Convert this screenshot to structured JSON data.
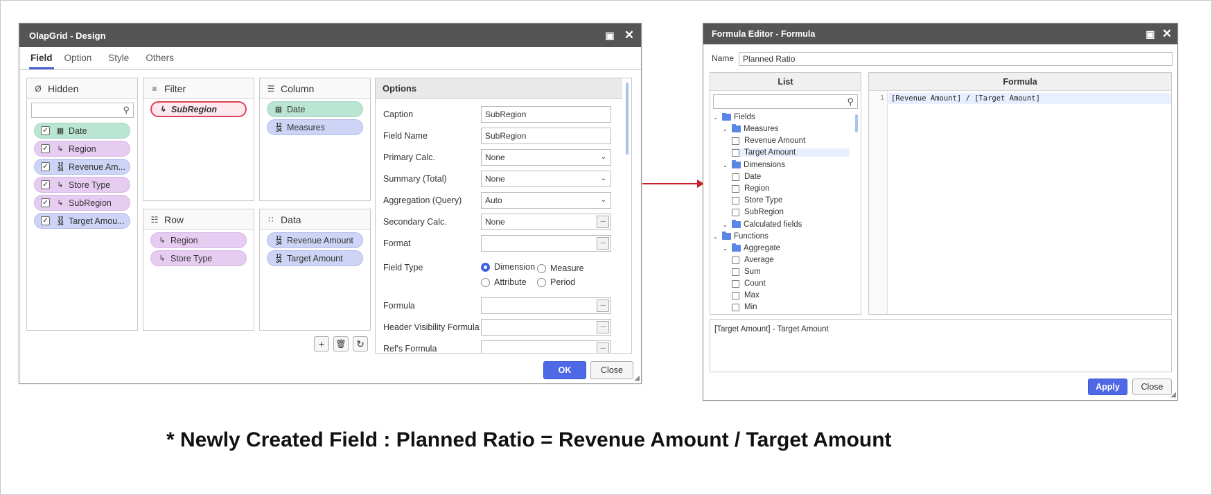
{
  "design_window": {
    "title": "OlapGrid - Design",
    "tabs": [
      "Field",
      "Option",
      "Style",
      "Others"
    ],
    "hidden_panel": {
      "title": "Hidden",
      "items": [
        {
          "label": "Date",
          "type": "date",
          "color": "green"
        },
        {
          "label": "Region",
          "type": "dimension",
          "color": "purple"
        },
        {
          "label": "Revenue Am...",
          "type": "measure",
          "color": "blue"
        },
        {
          "label": "Store Type",
          "type": "dimension",
          "color": "purple"
        },
        {
          "label": "SubRegion",
          "type": "dimension",
          "color": "purple"
        },
        {
          "label": "Target Amou...",
          "type": "measure",
          "color": "blue"
        }
      ]
    },
    "filter_panel": {
      "title": "Filter",
      "items": [
        {
          "label": "SubRegion"
        }
      ]
    },
    "column_panel": {
      "title": "Column",
      "items": [
        {
          "label": "Date"
        },
        {
          "label": "Measures"
        }
      ]
    },
    "row_panel": {
      "title": "Row",
      "items": [
        {
          "label": "Region"
        },
        {
          "label": "Store Type"
        }
      ]
    },
    "data_panel": {
      "title": "Data",
      "items": [
        {
          "label": "Revenue Amount"
        },
        {
          "label": "Target Amount"
        }
      ]
    },
    "options": {
      "title": "Options",
      "caption_label": "Caption",
      "caption_value": "SubRegion",
      "field_name_label": "Field Name",
      "field_name_value": "SubRegion",
      "primary_calc_label": "Primary Calc.",
      "primary_calc_value": "None",
      "summary_label": "Summary (Total)",
      "summary_value": "None",
      "aggregation_label": "Aggregation (Query)",
      "aggregation_value": "Auto",
      "secondary_calc_label": "Secondary Calc.",
      "secondary_calc_value": "None",
      "format_label": "Format",
      "format_value": "",
      "field_type_label": "Field Type",
      "field_types": [
        "Dimension",
        "Measure",
        "Attribute",
        "Period"
      ],
      "field_type_selected": "Dimension",
      "formula_label": "Formula",
      "header_visibility_label": "Header Visibility Formula",
      "refs_formula_label": "Ref's Formula"
    },
    "ok_label": "OK",
    "close_label": "Close"
  },
  "formula_window": {
    "title": "Formula Editor - Formula",
    "name_label": "Name",
    "name_value": "Planned Ratio",
    "list_header": "List",
    "formula_header": "Formula",
    "line_number": "1",
    "formula_text": "[Revenue Amount] / [Target Amount]",
    "tree": {
      "fields": "Fields",
      "measures": "Measures",
      "measure_items": [
        "Revenue Amount",
        "Target Amount"
      ],
      "dimensions": "Dimensions",
      "dimension_items": [
        "Date",
        "Region",
        "Store Type",
        "SubRegion"
      ],
      "calculated": "Calculated fields",
      "functions": "Functions",
      "aggregate": "Aggregate",
      "aggregate_items": [
        "Average",
        "Sum",
        "Count",
        "Max",
        "Min"
      ]
    },
    "description": "[Target Amount] - Target Amount",
    "apply_label": "Apply",
    "close_label": "Close"
  },
  "caption": "* Newly Created Field : Planned Ratio = Revenue Amount / Target Amount",
  "colors": {
    "accent": "#4f69e6",
    "arrow": "#cc1f2a",
    "titlebar": "#555555"
  }
}
